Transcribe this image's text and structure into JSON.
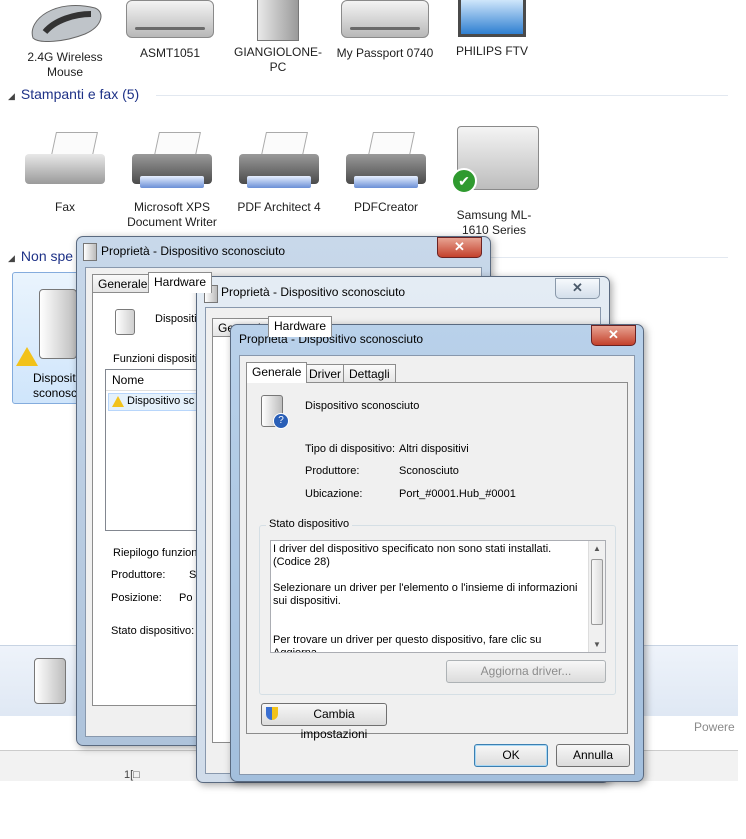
{
  "explorer": {
    "devices": [
      {
        "label": "2.4G Wireless Mouse",
        "icon": "mouse-icon"
      },
      {
        "label": "ASMT1051",
        "icon": "drive-icon"
      },
      {
        "label": "GIANGIOLONE-PC",
        "icon": "computer-icon"
      },
      {
        "label": "My Passport 0740",
        "icon": "drive-icon"
      },
      {
        "label": "PHILIPS FTV",
        "icon": "monitor-icon"
      }
    ],
    "printers_group": "Stampanti e fax (5)",
    "printers": [
      {
        "label": "Fax",
        "icon": "fax-icon"
      },
      {
        "label": "Microsoft XPS Document Writer",
        "icon": "printer-icon"
      },
      {
        "label": "PDF Architect 4",
        "icon": "printer-icon"
      },
      {
        "label": "PDFCreator",
        "icon": "printer-icon"
      },
      {
        "label": "Samsung ML-1610 Series",
        "icon": "default-printer-icon"
      }
    ],
    "unspecified_group": "Non spe",
    "unspecified_device_label": "Disposit sconosc",
    "right_edge_text": "Powere",
    "statusbar_glyph": "1[□"
  },
  "window1": {
    "title": "Proprietà - Dispositivo sconosciuto",
    "tabs": [
      "Generale",
      "Hardware"
    ],
    "device_name": "Dispositi",
    "functions_label": "Funzioni dispositi",
    "list_header": "Nome",
    "list_item": "Dispositivo sc",
    "summary_label": "Riepilogo funzion",
    "producer_label": "Produttore:",
    "producer_value": "S",
    "position_label": "Posizione:",
    "position_value": "Po",
    "status_label": "Stato dispositivo:"
  },
  "window2": {
    "title": "Proprietà - Dispositivo sconosciuto",
    "tabs": [
      "Generale",
      "Hardware"
    ]
  },
  "window3": {
    "title": "Proprietà - Dispositivo sconosciuto",
    "tabs": [
      "Generale",
      "Driver",
      "Dettagli"
    ],
    "device_name": "Dispositivo sconosciuto",
    "type_label": "Tipo di dispositivo:",
    "type_value": "Altri dispositivi",
    "producer_label": "Produttore:",
    "producer_value": "Sconosciuto",
    "location_label": "Ubicazione:",
    "location_value": "Port_#0001.Hub_#0001",
    "status_group": "Stato dispositivo",
    "status_text": "I driver del dispositivo specificato non sono stati installati. (Codice 28)\n\nSelezionare un driver per l'elemento o l'insieme di informazioni sui dispositivi.\n\n\nPer trovare un driver per questo dispositivo, fare clic su Aggiorna",
    "update_driver_button": "Aggiorna driver...",
    "change_settings_button": "Cambia impostazioni",
    "ok_button": "OK",
    "cancel_button": "Annulla"
  }
}
